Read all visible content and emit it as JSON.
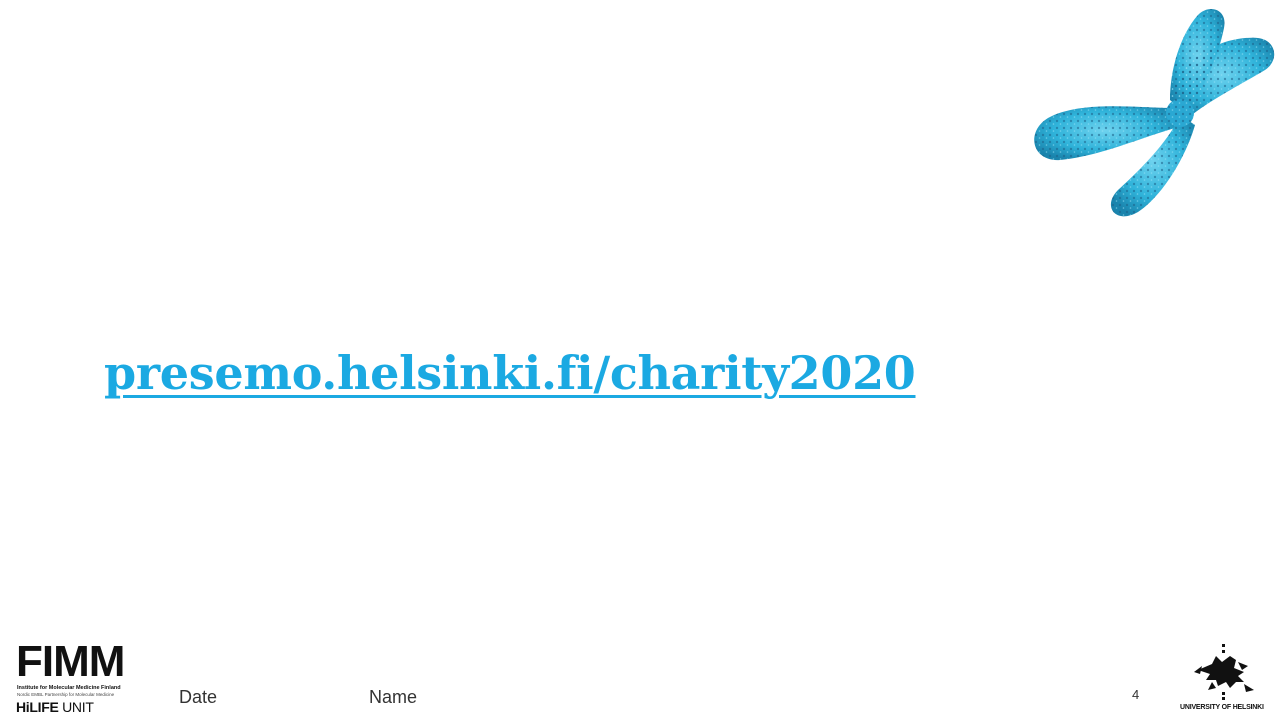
{
  "slide": {
    "link_text": "presemo.helsinki.fi/charity2020",
    "footer_date": "Date",
    "footer_name": "Name",
    "page_number": "4"
  },
  "logos": {
    "fimm_word": "FIMM",
    "fimm_line1": "Institute for Molecular Medicine Finland",
    "fimm_line2": "Nordic EMBL Partnership for Molecular Medicine",
    "fimm_line3_bold": "HiLIFE",
    "fimm_line3_rest": " UNIT",
    "uh_text": "UNIVERSITY OF HELSINKI"
  },
  "colors": {
    "link": "#1ba9e2",
    "chromosome": "#35b8dc"
  },
  "icons": {
    "chromosome": "chromosome-image",
    "uh_emblem": "university-of-helsinki-emblem"
  }
}
